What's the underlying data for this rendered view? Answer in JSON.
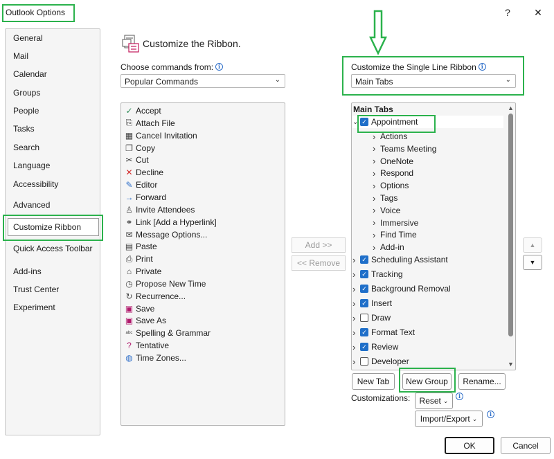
{
  "window": {
    "title": "Outlook Options",
    "help_label": "?",
    "close_label": "✕"
  },
  "nav": {
    "items": [
      "General",
      "Mail",
      "Calendar",
      "Groups",
      "People",
      "Tasks",
      "Search",
      "Language",
      "Accessibility",
      "Advanced",
      "Customize Ribbon",
      "Quick Access Toolbar",
      "Add-ins",
      "Trust Center",
      "Experiment"
    ],
    "selected": "Customize Ribbon"
  },
  "header": {
    "title": "Customize the Ribbon."
  },
  "choose": {
    "label": "Choose commands from:",
    "value": "Popular Commands"
  },
  "customize": {
    "label": "Customize the Single Line Ribbon",
    "value": "Main Tabs"
  },
  "commands": [
    {
      "label": "Accept",
      "icon": "check-icon"
    },
    {
      "label": "Attach File",
      "icon": "paperclip-icon"
    },
    {
      "label": "Cancel Invitation",
      "icon": "calendar-cancel-icon"
    },
    {
      "label": "Copy",
      "icon": "copy-icon"
    },
    {
      "label": "Cut",
      "icon": "scissors-icon"
    },
    {
      "label": "Decline",
      "icon": "x-icon"
    },
    {
      "label": "Editor",
      "icon": "pen-icon"
    },
    {
      "label": "Forward",
      "icon": "arrow-right-icon"
    },
    {
      "label": "Invite Attendees",
      "icon": "person-add-icon"
    },
    {
      "label": "Link [Add a Hyperlink]",
      "icon": "link-icon"
    },
    {
      "label": "Message Options...",
      "icon": "message-options-icon"
    },
    {
      "label": "Paste",
      "icon": "clipboard-icon"
    },
    {
      "label": "Print",
      "icon": "printer-icon"
    },
    {
      "label": "Private",
      "icon": "lock-icon"
    },
    {
      "label": "Propose New Time",
      "icon": "clock-icon"
    },
    {
      "label": "Recurrence...",
      "icon": "recurrence-icon"
    },
    {
      "label": "Save",
      "icon": "save-icon"
    },
    {
      "label": "Save As",
      "icon": "save-as-icon"
    },
    {
      "label": "Spelling & Grammar",
      "icon": "spelling-icon"
    },
    {
      "label": "Tentative",
      "icon": "question-icon"
    },
    {
      "label": "Time Zones...",
      "icon": "globe-icon"
    }
  ],
  "mid_buttons": {
    "add": "Add >>",
    "remove": "<< Remove"
  },
  "tree": {
    "heading": "Main Tabs",
    "appointment": "Appointment",
    "groups": [
      "Actions",
      "Teams Meeting",
      "OneNote",
      "Respond",
      "Options",
      "Tags",
      "Voice",
      "Immersive",
      "Find Time",
      "Add-in"
    ],
    "tabs": [
      {
        "label": "Scheduling Assistant",
        "checked": true
      },
      {
        "label": "Tracking",
        "checked": true
      },
      {
        "label": "Background Removal",
        "checked": true
      },
      {
        "label": "Insert",
        "checked": true
      },
      {
        "label": "Draw",
        "checked": false
      },
      {
        "label": "Format Text",
        "checked": true
      },
      {
        "label": "Review",
        "checked": true
      },
      {
        "label": "Developer",
        "checked": false
      }
    ]
  },
  "buttons": {
    "new_tab": "New Tab",
    "new_group": "New Group",
    "rename": "Rename...",
    "customizations_label": "Customizations:",
    "reset": "Reset",
    "import_export": "Import/Export",
    "ok": "OK",
    "cancel": "Cancel"
  },
  "colors": {
    "highlight": "#2bb24c",
    "checkbox": "#1f6fc9"
  }
}
